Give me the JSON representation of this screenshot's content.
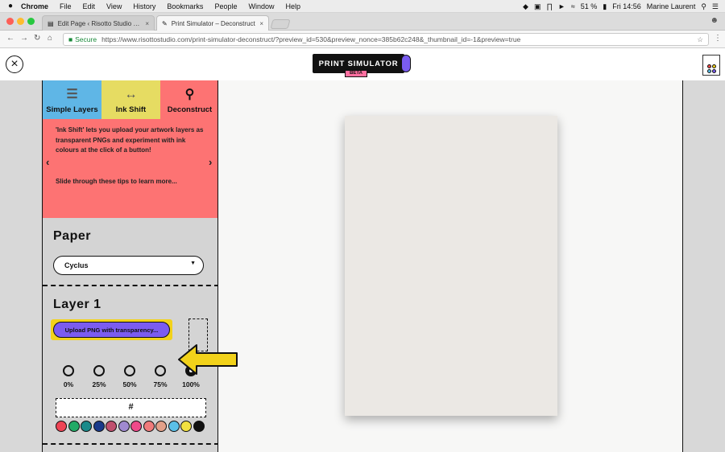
{
  "menubar": {
    "apple": "",
    "items": [
      "Chrome",
      "File",
      "Edit",
      "View",
      "History",
      "Bookmarks",
      "People",
      "Window",
      "Help"
    ],
    "battery": "51 %",
    "clock": "Fri 14:56",
    "user": "Marine Laurent"
  },
  "tabs": [
    {
      "title": "Edit Page ‹ Risotto Studio — V",
      "active": false
    },
    {
      "title": "Print Simulator – Deconstruct",
      "active": true
    }
  ],
  "address": {
    "secure": "Secure",
    "url": "https://www.risottostudio.com/print-simulator-deconstruct/?preview_id=530&preview_nonce=385b62c248&_thumbnail_id=-1&preview=true"
  },
  "header": {
    "logo_text": "PRINT SIMULATOR",
    "beta": "BETA"
  },
  "modes": [
    {
      "label": "Simple Layers",
      "icon": "layers-icon",
      "color": "#5fb6e6"
    },
    {
      "label": "Ink Shift",
      "icon": "ink-drop-icon",
      "color": "#e6dc62"
    },
    {
      "label": "Deconstruct",
      "icon": "magnifier-icon",
      "color": "#fd7373"
    }
  ],
  "tips": {
    "text1": "'Ink Shift' lets you upload your artwork layers as transparent PNGs and experiment with ink colours at the click of a button!",
    "text2": "Slide through these tips to learn more...",
    "prev": "‹",
    "next": "›"
  },
  "paper": {
    "title": "Paper",
    "selected": "Cyclus"
  },
  "layer": {
    "title": "Layer 1",
    "upload_label": "Upload PNG with transparency...",
    "opacities": [
      "0%",
      "25%",
      "50%",
      "75%",
      "100%"
    ],
    "selected_opacity": "100%",
    "hex_placeholder": "#",
    "swatches": [
      "#ee4455",
      "#22aa66",
      "#1a8a8a",
      "#1a3a8a",
      "#c0506e",
      "#a08ad0",
      "#f04a8a",
      "#f07b7b",
      "#e2a089",
      "#5bc0e8",
      "#f2e040",
      "#111111"
    ]
  }
}
